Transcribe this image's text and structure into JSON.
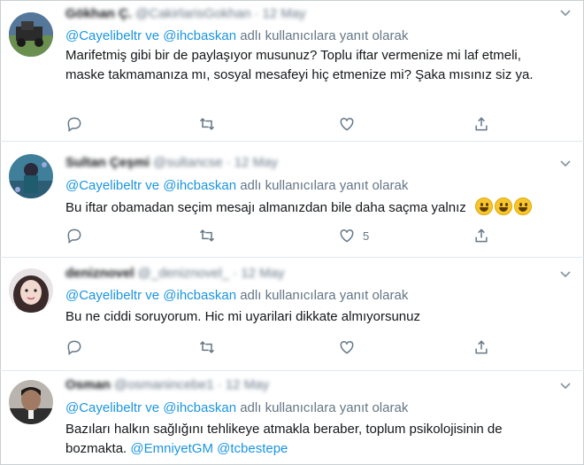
{
  "colors": {
    "link": "#1b95e0",
    "muted": "#657786",
    "text": "#14171a",
    "divider": "#e1e8ed"
  },
  "tweets": [
    {
      "name": "Gökhan Ç.",
      "handle": "@CakirlarisGokhan",
      "date": "· 12 May",
      "reply_mentions": "@Cayelibeltr ve @ihcbaskan",
      "reply_suffix": " adlı kullanıcılara yanıt olarak",
      "text": "Marifetmiş gibi bir de paylaşıyor musunuz? Toplu iftar vermenize mi laf etmeli, maske takmamanıza mı, sosyal mesafeyi hiç etmenize mi? Şaka mısınız siz ya.",
      "like_count": ""
    },
    {
      "name": "Sultan Çeşmi",
      "handle": "@sultancse",
      "date": "· 12 May",
      "reply_mentions": "@Cayelibeltr ve @ihcbaskan",
      "reply_suffix": " adlı kullanıcılara yanıt olarak",
      "text": "Bu iftar obamadan seçim mesajı almanızdan bile daha saçma yalnız",
      "like_count": "5"
    },
    {
      "name": "deniznovel",
      "handle": "@_deniznovel_",
      "date": "· 12 May",
      "reply_mentions": "@Cayelibeltr ve @ihcbaskan",
      "reply_suffix": " adlı kullanıcılara yanıt olarak",
      "text": "Bu ne ciddi soruyorum. Hic mi uyarilari dikkate almıyorsunuz",
      "like_count": ""
    },
    {
      "name": "Osman",
      "handle": "@osmanincebe1",
      "date": "· 12 May",
      "reply_mentions": "@Cayelibeltr ve @ihcbaskan",
      "reply_suffix": " adlı kullanıcılara yanıt olarak",
      "text_plain": "Bazıları halkın sağlığını tehlikeye atmakla beraber, toplum psikolojisinin de bozmakta. ",
      "text_mentions": "@EmniyetGM @tcbestepe",
      "like_count": ""
    }
  ],
  "icons": [
    "reply-icon",
    "retweet-icon",
    "like-icon",
    "share-icon",
    "caret-down-icon",
    "grinning-emoji"
  ]
}
